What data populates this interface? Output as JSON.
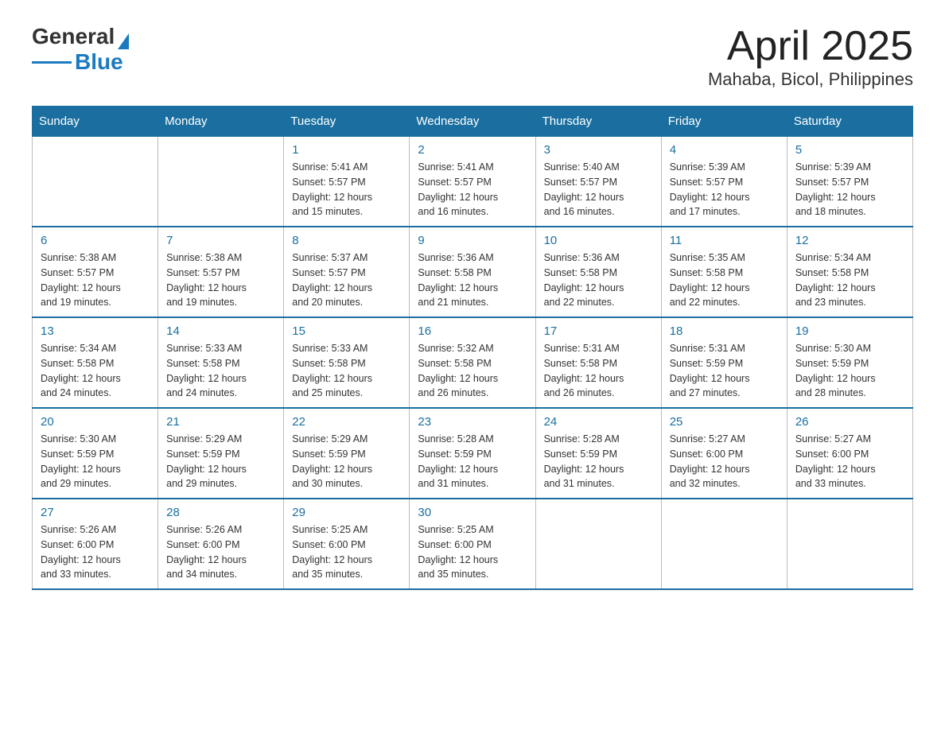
{
  "header": {
    "logo_general": "General",
    "logo_blue": "Blue",
    "title": "April 2025",
    "subtitle": "Mahaba, Bicol, Philippines"
  },
  "days_of_week": [
    "Sunday",
    "Monday",
    "Tuesday",
    "Wednesday",
    "Thursday",
    "Friday",
    "Saturday"
  ],
  "weeks": [
    [
      {
        "num": "",
        "info": ""
      },
      {
        "num": "",
        "info": ""
      },
      {
        "num": "1",
        "info": "Sunrise: 5:41 AM\nSunset: 5:57 PM\nDaylight: 12 hours\nand 15 minutes."
      },
      {
        "num": "2",
        "info": "Sunrise: 5:41 AM\nSunset: 5:57 PM\nDaylight: 12 hours\nand 16 minutes."
      },
      {
        "num": "3",
        "info": "Sunrise: 5:40 AM\nSunset: 5:57 PM\nDaylight: 12 hours\nand 16 minutes."
      },
      {
        "num": "4",
        "info": "Sunrise: 5:39 AM\nSunset: 5:57 PM\nDaylight: 12 hours\nand 17 minutes."
      },
      {
        "num": "5",
        "info": "Sunrise: 5:39 AM\nSunset: 5:57 PM\nDaylight: 12 hours\nand 18 minutes."
      }
    ],
    [
      {
        "num": "6",
        "info": "Sunrise: 5:38 AM\nSunset: 5:57 PM\nDaylight: 12 hours\nand 19 minutes."
      },
      {
        "num": "7",
        "info": "Sunrise: 5:38 AM\nSunset: 5:57 PM\nDaylight: 12 hours\nand 19 minutes."
      },
      {
        "num": "8",
        "info": "Sunrise: 5:37 AM\nSunset: 5:57 PM\nDaylight: 12 hours\nand 20 minutes."
      },
      {
        "num": "9",
        "info": "Sunrise: 5:36 AM\nSunset: 5:58 PM\nDaylight: 12 hours\nand 21 minutes."
      },
      {
        "num": "10",
        "info": "Sunrise: 5:36 AM\nSunset: 5:58 PM\nDaylight: 12 hours\nand 22 minutes."
      },
      {
        "num": "11",
        "info": "Sunrise: 5:35 AM\nSunset: 5:58 PM\nDaylight: 12 hours\nand 22 minutes."
      },
      {
        "num": "12",
        "info": "Sunrise: 5:34 AM\nSunset: 5:58 PM\nDaylight: 12 hours\nand 23 minutes."
      }
    ],
    [
      {
        "num": "13",
        "info": "Sunrise: 5:34 AM\nSunset: 5:58 PM\nDaylight: 12 hours\nand 24 minutes."
      },
      {
        "num": "14",
        "info": "Sunrise: 5:33 AM\nSunset: 5:58 PM\nDaylight: 12 hours\nand 24 minutes."
      },
      {
        "num": "15",
        "info": "Sunrise: 5:33 AM\nSunset: 5:58 PM\nDaylight: 12 hours\nand 25 minutes."
      },
      {
        "num": "16",
        "info": "Sunrise: 5:32 AM\nSunset: 5:58 PM\nDaylight: 12 hours\nand 26 minutes."
      },
      {
        "num": "17",
        "info": "Sunrise: 5:31 AM\nSunset: 5:58 PM\nDaylight: 12 hours\nand 26 minutes."
      },
      {
        "num": "18",
        "info": "Sunrise: 5:31 AM\nSunset: 5:59 PM\nDaylight: 12 hours\nand 27 minutes."
      },
      {
        "num": "19",
        "info": "Sunrise: 5:30 AM\nSunset: 5:59 PM\nDaylight: 12 hours\nand 28 minutes."
      }
    ],
    [
      {
        "num": "20",
        "info": "Sunrise: 5:30 AM\nSunset: 5:59 PM\nDaylight: 12 hours\nand 29 minutes."
      },
      {
        "num": "21",
        "info": "Sunrise: 5:29 AM\nSunset: 5:59 PM\nDaylight: 12 hours\nand 29 minutes."
      },
      {
        "num": "22",
        "info": "Sunrise: 5:29 AM\nSunset: 5:59 PM\nDaylight: 12 hours\nand 30 minutes."
      },
      {
        "num": "23",
        "info": "Sunrise: 5:28 AM\nSunset: 5:59 PM\nDaylight: 12 hours\nand 31 minutes."
      },
      {
        "num": "24",
        "info": "Sunrise: 5:28 AM\nSunset: 5:59 PM\nDaylight: 12 hours\nand 31 minutes."
      },
      {
        "num": "25",
        "info": "Sunrise: 5:27 AM\nSunset: 6:00 PM\nDaylight: 12 hours\nand 32 minutes."
      },
      {
        "num": "26",
        "info": "Sunrise: 5:27 AM\nSunset: 6:00 PM\nDaylight: 12 hours\nand 33 minutes."
      }
    ],
    [
      {
        "num": "27",
        "info": "Sunrise: 5:26 AM\nSunset: 6:00 PM\nDaylight: 12 hours\nand 33 minutes."
      },
      {
        "num": "28",
        "info": "Sunrise: 5:26 AM\nSunset: 6:00 PM\nDaylight: 12 hours\nand 34 minutes."
      },
      {
        "num": "29",
        "info": "Sunrise: 5:25 AM\nSunset: 6:00 PM\nDaylight: 12 hours\nand 35 minutes."
      },
      {
        "num": "30",
        "info": "Sunrise: 5:25 AM\nSunset: 6:00 PM\nDaylight: 12 hours\nand 35 minutes."
      },
      {
        "num": "",
        "info": ""
      },
      {
        "num": "",
        "info": ""
      },
      {
        "num": "",
        "info": ""
      }
    ]
  ]
}
